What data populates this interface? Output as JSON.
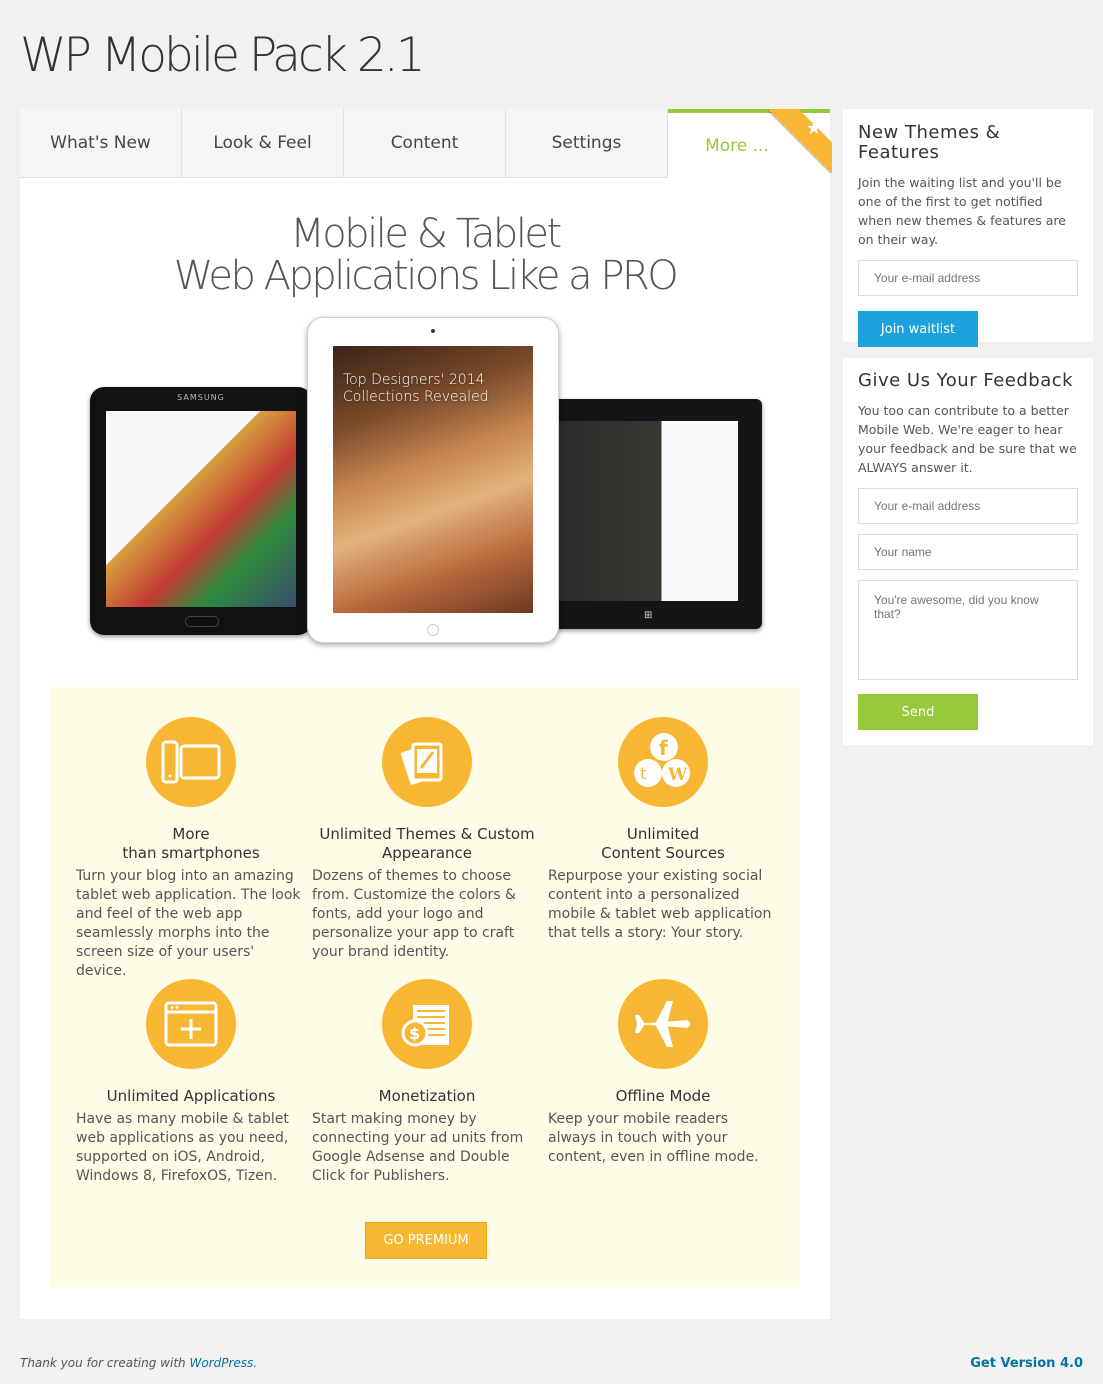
{
  "page_title": "WP Mobile Pack 2.1",
  "tabs": [
    {
      "label": "What's New"
    },
    {
      "label": "Look & Feel"
    },
    {
      "label": "Content"
    },
    {
      "label": "Settings"
    },
    {
      "label": "More ...",
      "active": true
    }
  ],
  "hero": {
    "line1": "Mobile & Tablet",
    "line2": "Web Applications Like a PRO"
  },
  "devices": {
    "left_brand": "SAMSUNG",
    "center_headline_1": "Top Designers' 2014",
    "center_headline_2": "Collections Revealed"
  },
  "features": [
    {
      "title_1": "More",
      "title_2": "than smartphones",
      "text": "Turn your blog into an amazing tablet web application. The look and feel of the web app seamlessly morphs into the screen size of your users' device.",
      "icon": "tablet-icon"
    },
    {
      "title_1": "Unlimited Themes & Custom",
      "title_2": "Appearance",
      "text": "Dozens of themes to choose from. Customize the colors & fonts, add your logo and personalize your app to craft your brand identity.",
      "icon": "themes-icon"
    },
    {
      "title_1": "Unlimited",
      "title_2": "Content Sources",
      "text": "Repurpose your existing social content into a personalized mobile & tablet web application that tells a story: Your story.",
      "icon": "social-sources-icon"
    },
    {
      "title_1": "Unlimited Applications",
      "title_2": "",
      "text": "Have as many mobile & tablet web applications as you need, supported on iOS, Android, Windows 8, FirefoxOS, Tizen.",
      "icon": "add-window-icon"
    },
    {
      "title_1": "Monetization",
      "title_2": "",
      "text": "Start making money by connecting your ad units from Google Adsense and Double Click for Publishers.",
      "icon": "money-icon"
    },
    {
      "title_1": "Offline Mode",
      "title_2": "",
      "text": "Keep your mobile readers always in touch with your content, even in offline mode.",
      "icon": "airplane-icon"
    }
  ],
  "go_premium_label": "GO PREMIUM",
  "waitlist": {
    "title": "New Themes & Features",
    "text": "Join the waiting list and you'll be one of the first to get notified when new themes & features are on their way.",
    "email_placeholder": "Your e-mail address",
    "button": "Join waitlist"
  },
  "feedback": {
    "title": "Give Us Your Feedback",
    "text": "You too can contribute to a better Mobile Web. We're eager to hear your feedback and be sure that we ALWAYS answer it.",
    "email_placeholder": "Your e-mail address",
    "name_placeholder": "Your name",
    "message_placeholder": "You're awesome, did you know that?",
    "button": "Send"
  },
  "footer": {
    "thanks_prefix": "Thank you for creating with",
    "thanks_link": "WordPress",
    "thanks_suffix": ".",
    "version_link": "Get Version 4.0"
  },
  "colors": {
    "accent_green": "#97c93c",
    "accent_orange": "#f7b733",
    "accent_blue": "#1ea1dc",
    "features_bg": "#fefbe7"
  }
}
